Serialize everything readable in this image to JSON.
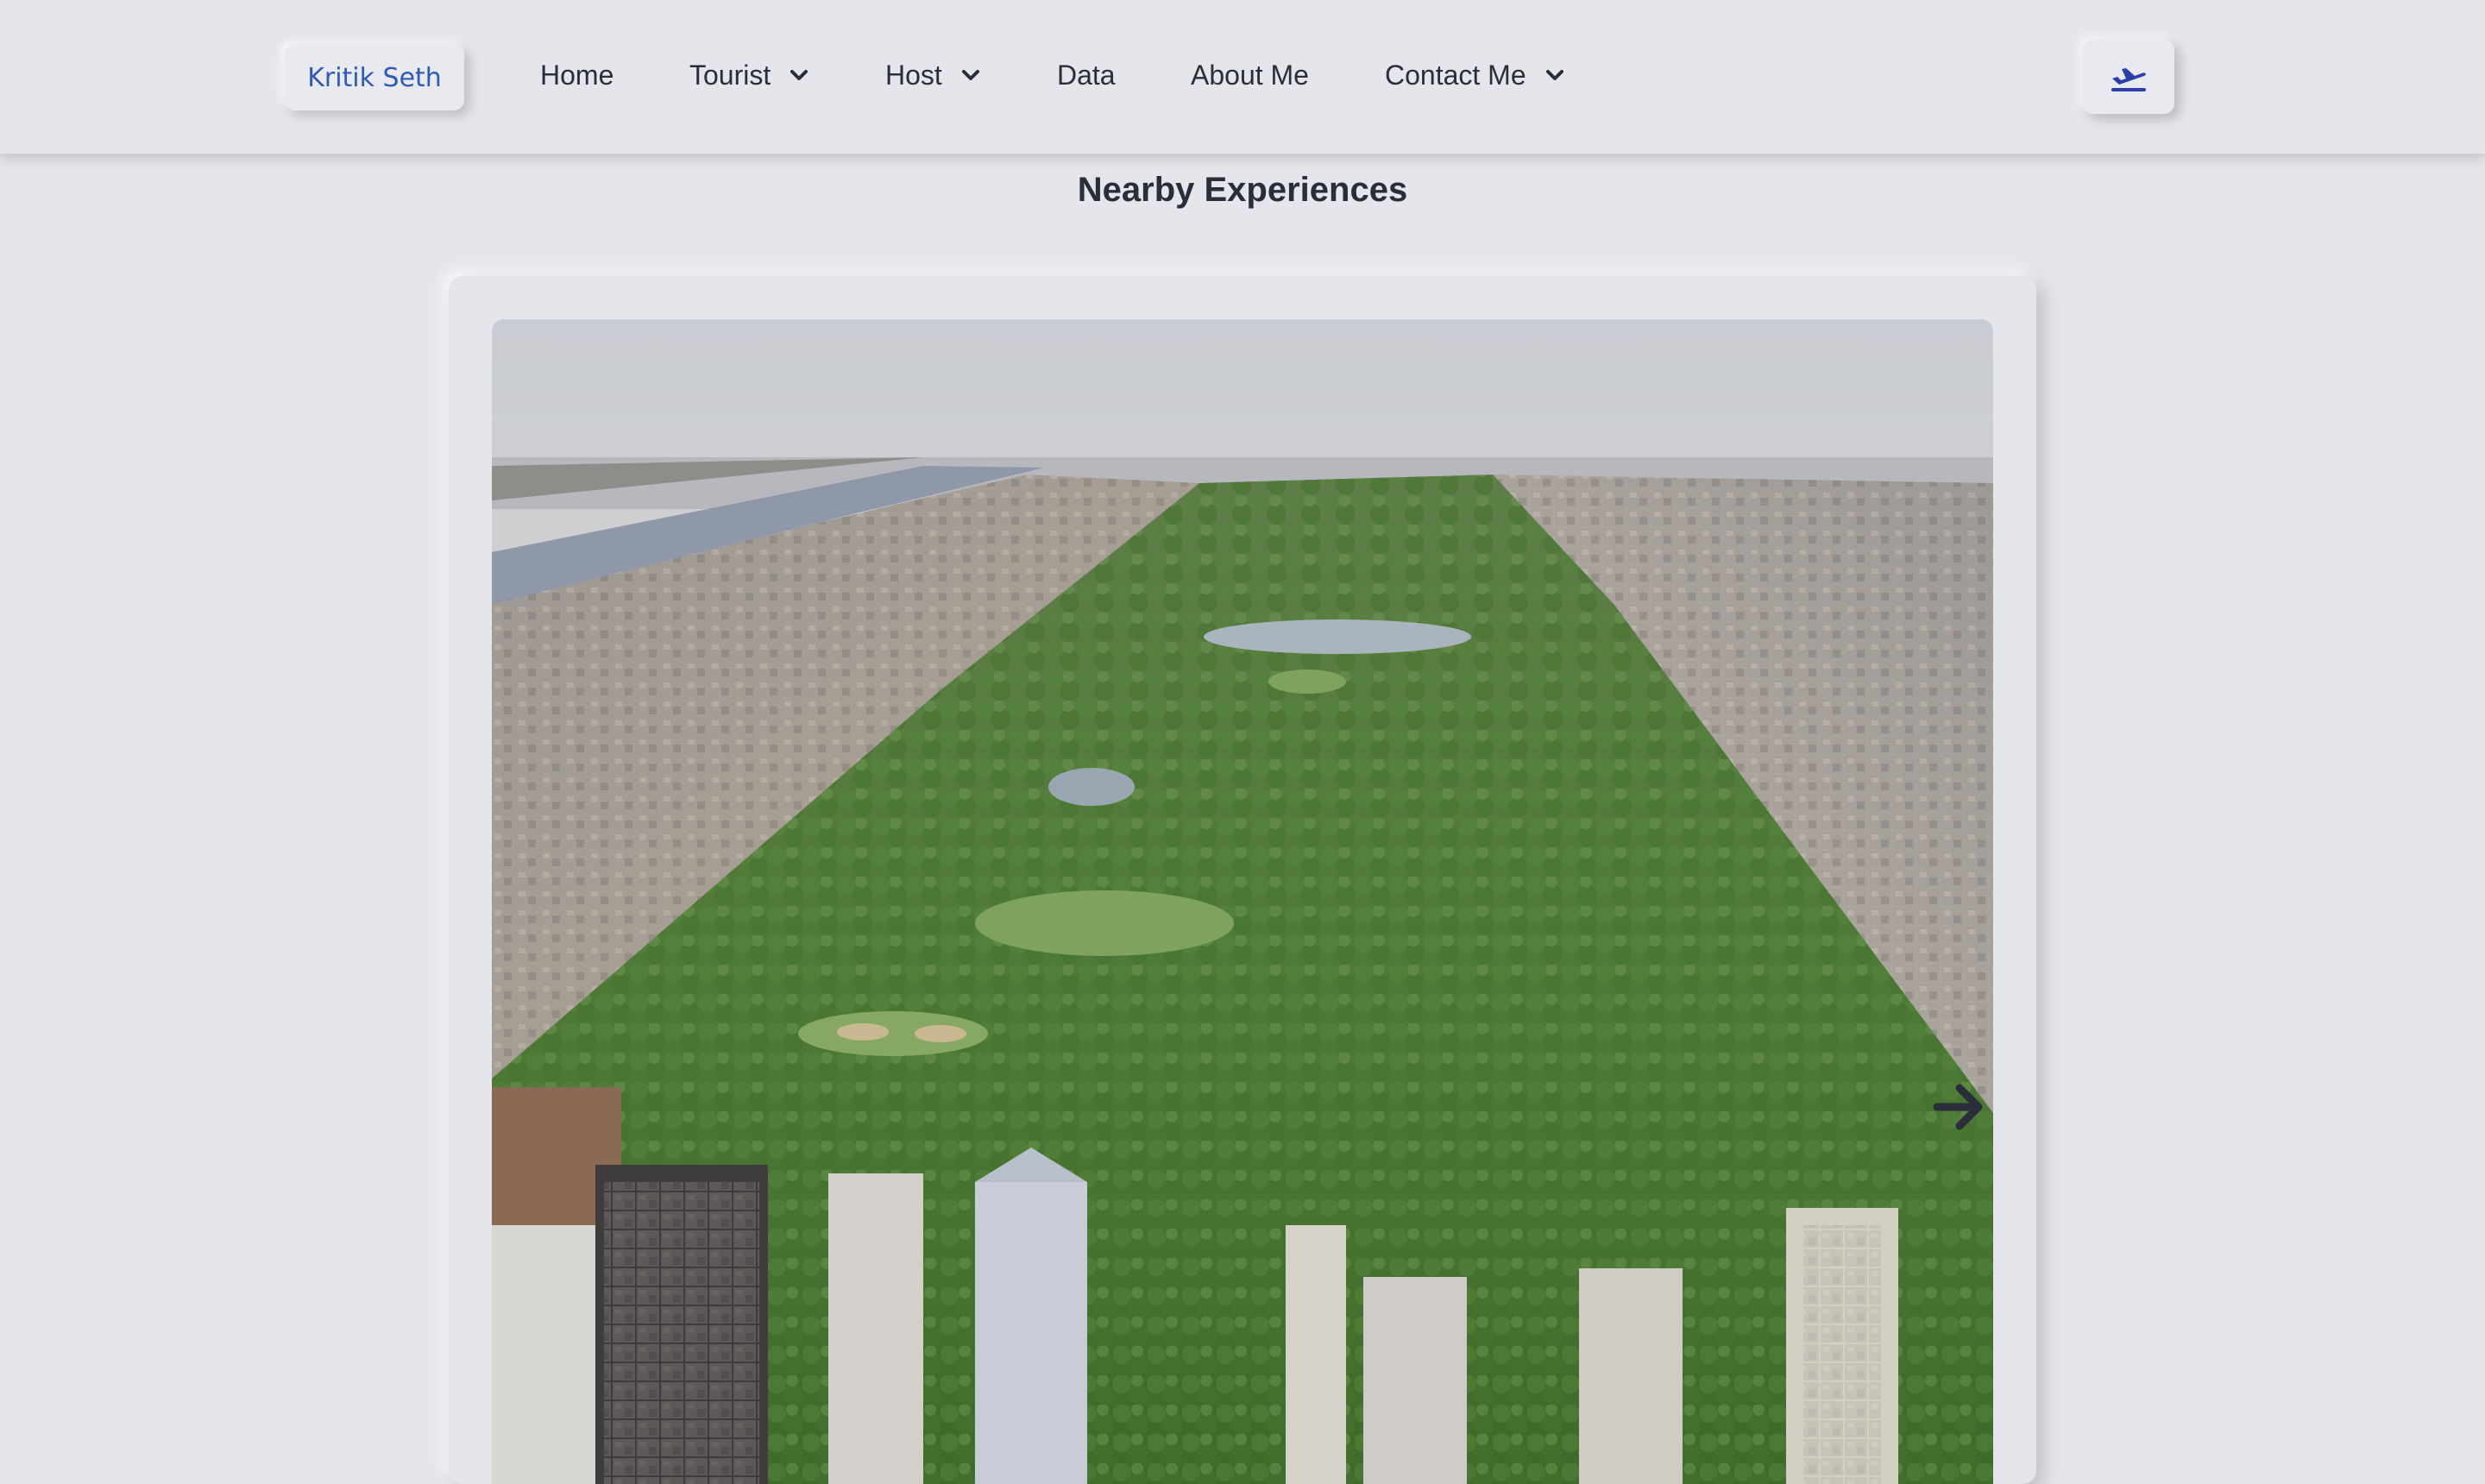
{
  "nav": {
    "brand": "Kritik Seth",
    "items": [
      {
        "label": "Home",
        "has_dropdown": false
      },
      {
        "label": "Tourist",
        "has_dropdown": true
      },
      {
        "label": "Host",
        "has_dropdown": true
      },
      {
        "label": "Data",
        "has_dropdown": false
      },
      {
        "label": "About Me",
        "has_dropdown": false
      },
      {
        "label": "Contact Me",
        "has_dropdown": true
      }
    ],
    "theme_icon": "airplane-departure-icon"
  },
  "section": {
    "title": "Nearby Experiences"
  },
  "carousel": {
    "image_subject": "aerial-city-park",
    "next_icon": "arrow-right-icon"
  },
  "colors": {
    "background": "#e4e6ec",
    "brand_text": "#2f5bb5",
    "icon_accent": "#2a3fa8",
    "text": "#2b2d3a"
  }
}
